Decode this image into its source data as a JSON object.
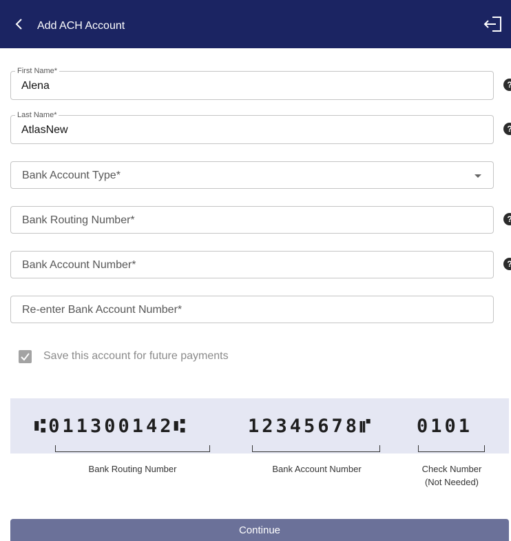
{
  "header": {
    "title": "Add ACH Account",
    "back_icon": "chevron-left-icon",
    "logout_icon": "logout-icon",
    "background": "#1b2462"
  },
  "form": {
    "first_name": {
      "label": "First Name*",
      "value": "Alena"
    },
    "last_name": {
      "label": "Last Name*",
      "value": "AtlasNew"
    },
    "account_type": {
      "placeholder": "Bank Account Type*"
    },
    "routing_number": {
      "placeholder": "Bank Routing Number*"
    },
    "account_number": {
      "placeholder": "Bank Account Number*"
    },
    "reenter_account_number": {
      "placeholder": "Re-enter Bank Account Number*"
    },
    "help_glyph": "?"
  },
  "save_account": {
    "label": "Save this account for future payments",
    "checked": true
  },
  "check_diagram": {
    "routing_micr": "⑆011300142⑆",
    "account_micr": "12345678⑈",
    "check_micr": "0101",
    "routing_caption": "Bank Routing Number",
    "account_caption": "Bank Account Number",
    "check_caption_line1": "Check Number",
    "check_caption_line2": "(Not Needed)"
  },
  "continue": {
    "label": "Continue",
    "color": "#6b7199"
  }
}
